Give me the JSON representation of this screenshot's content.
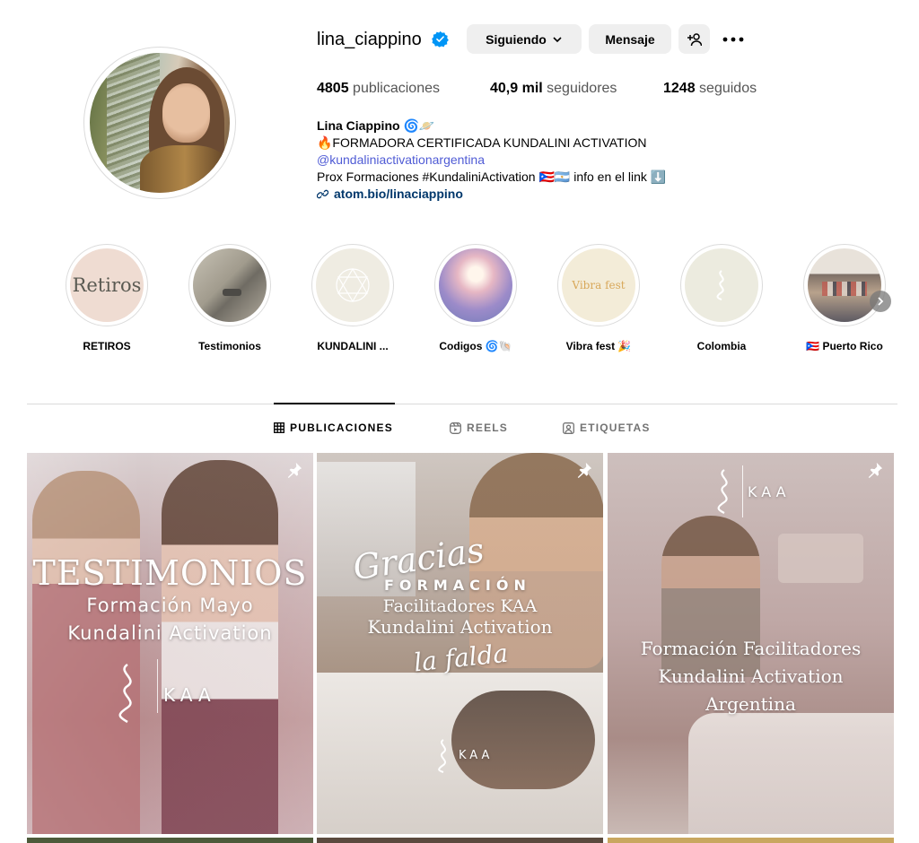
{
  "profile": {
    "username": "lina_ciappino",
    "buttons": {
      "following": "Siguiendo",
      "message": "Mensaje"
    },
    "stats": {
      "posts_value": "4805",
      "posts_label": "publicaciones",
      "followers_value": "40,9 mil",
      "followers_label": "seguidores",
      "following_value": "1248",
      "following_label": "seguidos"
    },
    "bio": {
      "name": "Lina Ciappino 🌀🪐",
      "line1": "🔥FORMADORA CERTIFICADA KUNDALINI ACTIVATION",
      "mention": "@kundaliniactivationargentina",
      "line3": "Prox Formaciones #KundaliniActivation 🇵🇷🇦🇷 info en el link ⬇️",
      "link": "atom.bio/linaciappino"
    }
  },
  "highlights": [
    {
      "label": "RETIROS",
      "cover_text": "Retiros"
    },
    {
      "label": "Testimonios"
    },
    {
      "label": "KUNDALINI ..."
    },
    {
      "label": "Codigos 🌀🐚"
    },
    {
      "label": "Vibra fest 🎉",
      "cover_text": "Vibra fest"
    },
    {
      "label": "Colombia"
    },
    {
      "label": "🇵🇷 Puerto Rico"
    }
  ],
  "tabs": [
    {
      "label": "PUBLICACIONES",
      "active": true,
      "icon": "grid-icon"
    },
    {
      "label": "REELS",
      "active": false,
      "icon": "reels-icon"
    },
    {
      "label": "ETIQUETAS",
      "active": false,
      "icon": "tagged-icon"
    }
  ],
  "posts": [
    {
      "title": "TESTIMONIOS",
      "line1": "Formación Mayo",
      "line2": "Kundalini Activation",
      "brand": "KAA"
    },
    {
      "script1": "Gracias",
      "title": "FORMACIÓN",
      "line1": "Facilitadores KAA",
      "line2": "Kundalini Activation",
      "script2": "la falda",
      "brand": "KAA"
    },
    {
      "brand": "KAA",
      "line1": "Formación Facilitadores",
      "line2": "Kundalini Activation",
      "line3": "Argentina"
    }
  ],
  "colors": {
    "verified": "#0095f6",
    "mention": "#4f5bd5",
    "link": "#00376b",
    "button_bg": "#efefef"
  }
}
